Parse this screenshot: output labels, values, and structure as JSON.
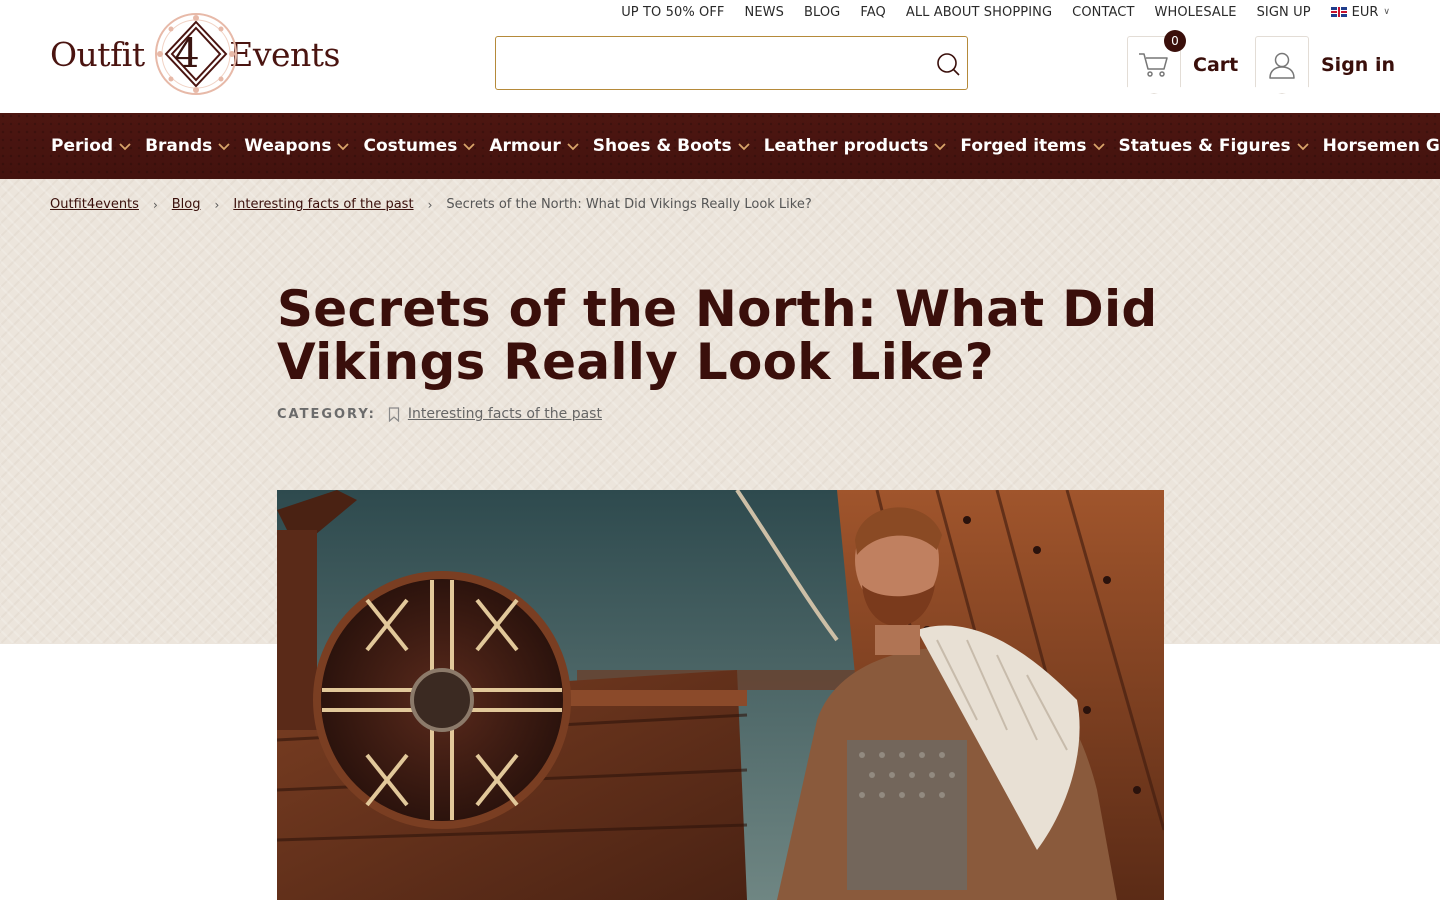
{
  "topbar": {
    "links": [
      "UP TO 50% OFF",
      "NEWS",
      "BLOG",
      "FAQ",
      "ALL ABOUT SHOPPING",
      "CONTACT",
      "WHOLESALE",
      "SIGN UP"
    ],
    "currency": "EUR"
  },
  "logo": {
    "left": "Outfit",
    "number": "4",
    "right": "Events"
  },
  "search": {
    "value": "",
    "placeholder": ""
  },
  "cart": {
    "count": "0",
    "label": "Cart"
  },
  "account": {
    "label": "Sign in"
  },
  "categories": [
    "Period",
    "Brands",
    "Weapons",
    "Costumes",
    "Armour",
    "Shoes & Boots",
    "Leather products",
    "Forged items",
    "Statues & Figures",
    "Horsemen Gear"
  ],
  "breadcrumb": {
    "items": [
      "Outfit4events",
      "Blog",
      "Interesting facts of the past"
    ],
    "current": "Secrets of the North: What Did Vikings Really Look Like?"
  },
  "article": {
    "title": "Secrets of the North: What Did Vikings Really Look Like?",
    "category_label": "CATEGORY:",
    "category": "Interesting facts of the past"
  },
  "colors": {
    "brand_dark": "#3a0f0b",
    "nav_bg": "#4a1510",
    "hero_bg": "#ece5dc",
    "search_border": "#b58a3a"
  }
}
